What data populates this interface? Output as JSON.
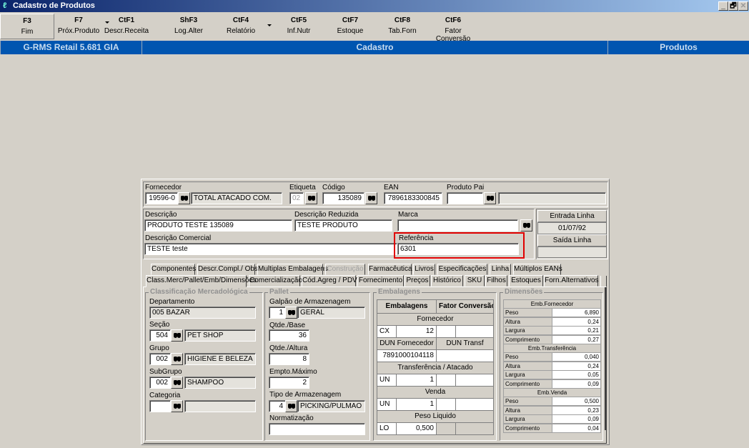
{
  "window": {
    "title": "Cadastro de Produtos",
    "controls": [
      "_",
      "🗗",
      "✕"
    ]
  },
  "toolbar": [
    {
      "key": "F3",
      "label": "Fim"
    },
    {
      "key": "F7",
      "label": "Próx.Produto"
    },
    {
      "key": "CtF1",
      "label": "Descr.Receita"
    },
    {
      "key": "ShF3",
      "label": "Log.Alter"
    },
    {
      "key": "CtF4",
      "label": "Relatório"
    },
    {
      "key": "CtF5",
      "label": "Inf.Nutr"
    },
    {
      "key": "CtF7",
      "label": "Estoque"
    },
    {
      "key": "CtF8",
      "label": "Tab.Forn"
    },
    {
      "key": "CtF6",
      "label": "Fator Conversão"
    }
  ],
  "header": {
    "app": "G-RMS Retail 5.681 GIA",
    "module": "Cadastro",
    "section": "Produtos"
  },
  "form": {
    "fornecedor": {
      "label": "Fornecedor",
      "code": "19596-0",
      "name": "TOTAL ATACADO COM."
    },
    "etiqueta": {
      "label": "Etiqueta",
      "value": "02"
    },
    "codigo": {
      "label": "Código",
      "value": "135089"
    },
    "ean": {
      "label": "EAN",
      "value": "7896183300845"
    },
    "produto_pai": {
      "label": "Produto Pai",
      "value": "",
      "name": ""
    },
    "descricao": {
      "label": "Descrição",
      "value": "PRODUTO TESTE 135089"
    },
    "descricao_reduzida": {
      "label": "Descrição Reduzida",
      "value": "TESTE PRODUTO"
    },
    "marca": {
      "label": "Marca",
      "value": ""
    },
    "descricao_comercial": {
      "label": "Descrição Comercial",
      "value": "TESTE teste"
    },
    "referencia": {
      "label": "Referência",
      "value": "6301"
    },
    "entrada_linha": {
      "label": "Entrada Linha",
      "value": "01/07/92"
    },
    "saida_linha": {
      "label": "Saída Linha",
      "value": ""
    }
  },
  "tabs_row1": [
    "Componentes",
    "Descr.Compl./ Obs",
    "Multiplas Embalagens",
    "Construção",
    "Farmacêutica",
    "Livros",
    "Especificações",
    "Linha",
    "Múltiplos EANs"
  ],
  "tabs_row2": [
    "Class.Merc/Pallet/Emb/Dimensões",
    "Comercialização",
    "Cód.Agreg / PDV",
    "Fornecimento",
    "Preços",
    "Histórico",
    "SKU",
    "Filhos",
    "Estoques",
    "Forn.Alternativos"
  ],
  "classificacao": {
    "title": "Classificação Mercadológica",
    "departamento": {
      "label": "Departamento",
      "value": "005 BAZAR"
    },
    "secao": {
      "label": "Seção",
      "code": "504",
      "name": "PET SHOP"
    },
    "grupo": {
      "label": "Grupo",
      "code": "002",
      "name": "HIGIENE E BELEZA"
    },
    "subgrupo": {
      "label": "SubGrupo",
      "code": "002",
      "name": "SHAMPOO"
    },
    "categoria": {
      "label": "Categoria",
      "code": "",
      "name": ""
    }
  },
  "pallet": {
    "title": "Pallet",
    "galpao": {
      "label": "Galpão de Armazenagem",
      "code": "1",
      "name": "GERAL"
    },
    "qtde_base": {
      "label": "Qtde./Base",
      "value": "36"
    },
    "qtde_altura": {
      "label": "Qtde./Altura",
      "value": "8"
    },
    "empto_maximo": {
      "label": "Empto.Máximo",
      "value": "2"
    },
    "tipo": {
      "label": "Tipo de Armazenagem",
      "code": "4",
      "name": "PICKING/PULMAO"
    },
    "normatizacao": {
      "label": "Normatização",
      "value": ""
    }
  },
  "embalagens": {
    "title": "Embalagens",
    "col1": "Embalagens",
    "col2": "Fator Conversão",
    "fornecedor": "Fornecedor",
    "forn_un": "CX",
    "forn_qtd": "12",
    "dun_forn": "DUN Fornecedor",
    "dun_transf": "DUN Transf",
    "dun_forn_value": "7891000104118",
    "dun_transf_value": "",
    "transferencia": "Transferência / Atacado",
    "transf_un": "UN",
    "transf_qtd": "1",
    "venda": "Venda",
    "venda_un": "UN",
    "venda_qtd": "1",
    "peso_liquido": "Peso Liquido",
    "peso_un": "LO",
    "peso_value": "0,500"
  },
  "dimensoes": {
    "title": "Dimensões",
    "groups": [
      {
        "name": "Emb.Fornecedor",
        "rows": [
          [
            "Peso",
            "6,890"
          ],
          [
            "Altura",
            "0,24"
          ],
          [
            "Largura",
            "0,21"
          ],
          [
            "Comprimento",
            "0,27"
          ]
        ]
      },
      {
        "name": "Emb.Transferência",
        "rows": [
          [
            "Peso",
            "0,040"
          ],
          [
            "Altura",
            "0,24"
          ],
          [
            "Largura",
            "0,05"
          ],
          [
            "Comprimento",
            "0,09"
          ]
        ]
      },
      {
        "name": "Emb.Venda",
        "rows": [
          [
            "Peso",
            "0,500"
          ],
          [
            "Altura",
            "0,23"
          ],
          [
            "Largura",
            "0,09"
          ],
          [
            "Comprimento",
            "0,04"
          ]
        ]
      }
    ]
  },
  "colors": {
    "header_blue": "#0055b0",
    "highlight": "#e00000",
    "background": "#d4d0c8"
  }
}
